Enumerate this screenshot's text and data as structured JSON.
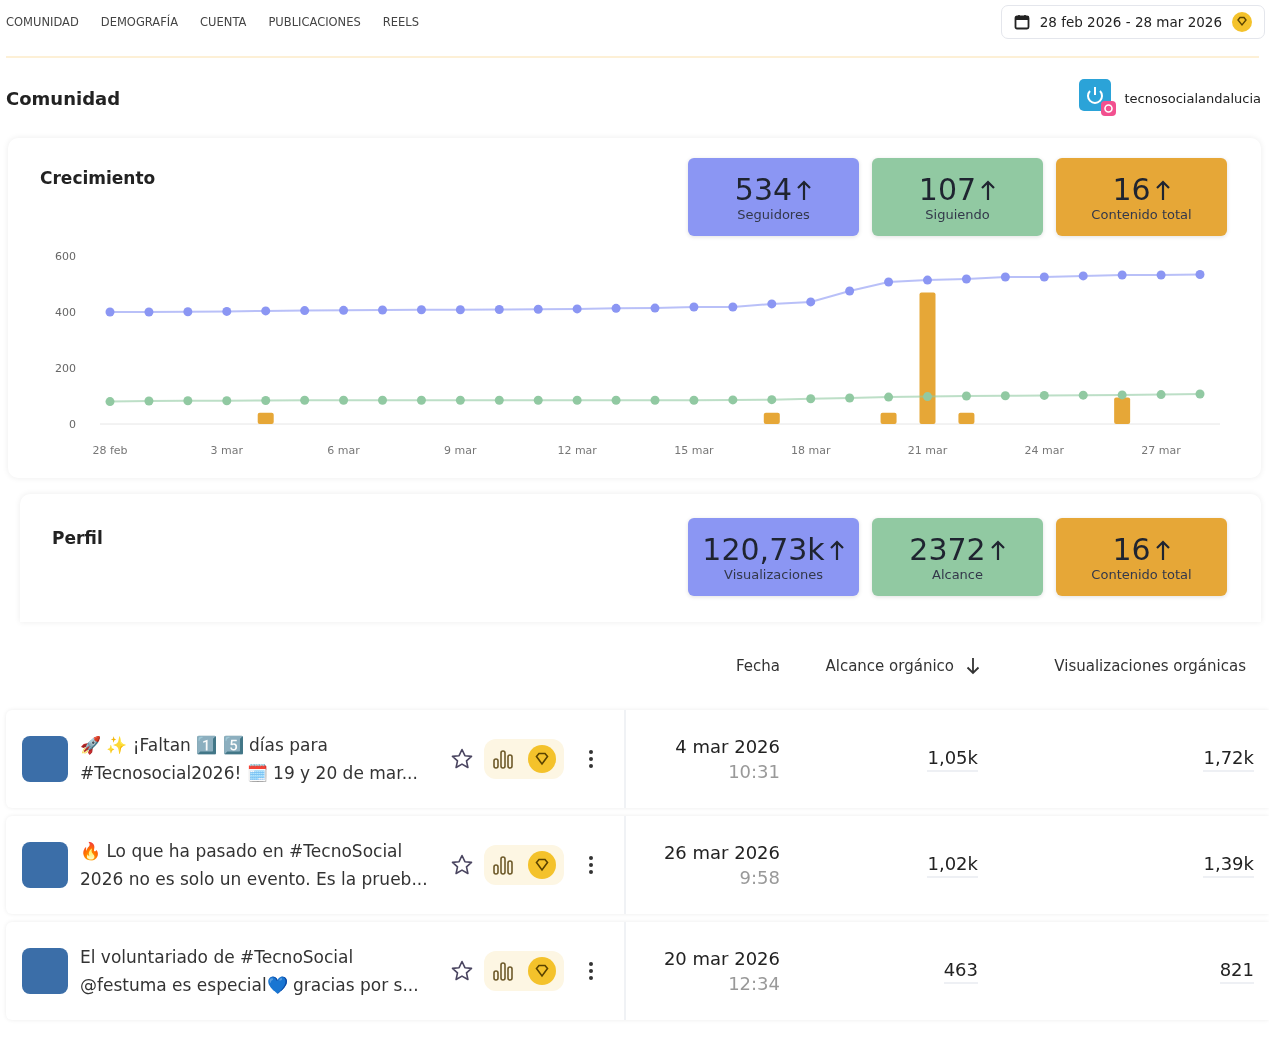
{
  "tabs": [
    {
      "label": "COMUNIDAD"
    },
    {
      "label": "DEMOGRAFÍA"
    },
    {
      "label": "CUENTA"
    },
    {
      "label": "PUBLICACIONES"
    },
    {
      "label": "REELS"
    }
  ],
  "date_range": "28 feb 2026 - 28 mar 2026",
  "section_title": "Comunidad",
  "account": "tecnosocialandalucia",
  "growth": {
    "title": "Crecimiento",
    "stats": [
      {
        "value": "534",
        "label": "Seguidores",
        "color": "#8b96f3"
      },
      {
        "value": "107",
        "label": "Siguiendo",
        "color": "#91c9a2"
      },
      {
        "value": "16",
        "label": "Contenido total",
        "color": "#e6a737"
      }
    ],
    "chart_data": {
      "type": "line",
      "categories": [
        "28 feb",
        null,
        null,
        "3 mar",
        null,
        null,
        "6 mar",
        null,
        null,
        "9 mar",
        null,
        null,
        "12 mar",
        null,
        null,
        "15 mar",
        null,
        null,
        "18 mar",
        null,
        null,
        "21 mar",
        null,
        null,
        "24 mar",
        null,
        null,
        "27 mar",
        null
      ],
      "ylim": [
        0,
        600
      ],
      "yticks": [
        0,
        200,
        400,
        600
      ],
      "series": [
        {
          "type": "line",
          "marker": true,
          "color": "#8b96f3",
          "values": [
            400,
            400,
            401,
            402,
            404,
            405,
            406,
            407,
            408,
            408,
            409,
            410,
            411,
            413,
            414,
            418,
            418,
            429,
            436,
            475,
            507,
            514,
            518,
            525,
            525,
            529,
            532,
            532,
            534
          ]
        },
        {
          "type": "line",
          "marker": true,
          "color": "#91c9a2",
          "values": [
            80,
            82,
            83,
            83,
            84,
            85,
            85,
            85,
            85,
            85,
            85,
            85,
            85,
            85,
            85,
            85,
            86,
            87,
            90,
            93,
            96,
            98,
            100,
            101,
            102,
            103,
            104,
            105,
            107
          ]
        },
        {
          "type": "bar",
          "color": "#e6a737",
          "values": [
            0,
            0,
            0,
            0,
            40,
            0,
            0,
            0,
            0,
            0,
            0,
            0,
            0,
            0,
            0,
            0,
            0,
            40,
            0,
            0,
            40,
            470,
            40,
            0,
            0,
            0,
            95,
            0,
            0
          ]
        }
      ]
    }
  },
  "profile": {
    "title": "Perfil",
    "stats": [
      {
        "value": "120,73k",
        "label": "Visualizaciones",
        "color": "#8b96f3"
      },
      {
        "value": "2372",
        "label": "Alcance",
        "color": "#91c9a2"
      },
      {
        "value": "16",
        "label": "Contenido total",
        "color": "#e6a737"
      }
    ]
  },
  "table": {
    "columns": [
      "Fecha",
      "Alcance orgánico",
      "Visualizaciones orgánicas"
    ],
    "rows": [
      {
        "caption": "🚀 ✨ ¡Faltan 1️⃣ 5️⃣ días para #Tecnosocial2026! 🗓️ 19 y 20 de mar...",
        "date": "4 mar 2026",
        "time": "10:31",
        "reach": "1,05k",
        "views": "1,72k"
      },
      {
        "caption": "🔥 Lo que ha pasado en #TecnoSocial 2026 no es solo un evento. Es la prueb...",
        "date": "26 mar 2026",
        "time": "9:58",
        "reach": "1,02k",
        "views": "1,39k"
      },
      {
        "caption": "El voluntariado de #TecnoSocial @festuma es especial💙 gracias por s...",
        "date": "20 mar 2026",
        "time": "12:34",
        "reach": "463",
        "views": "821"
      }
    ]
  }
}
